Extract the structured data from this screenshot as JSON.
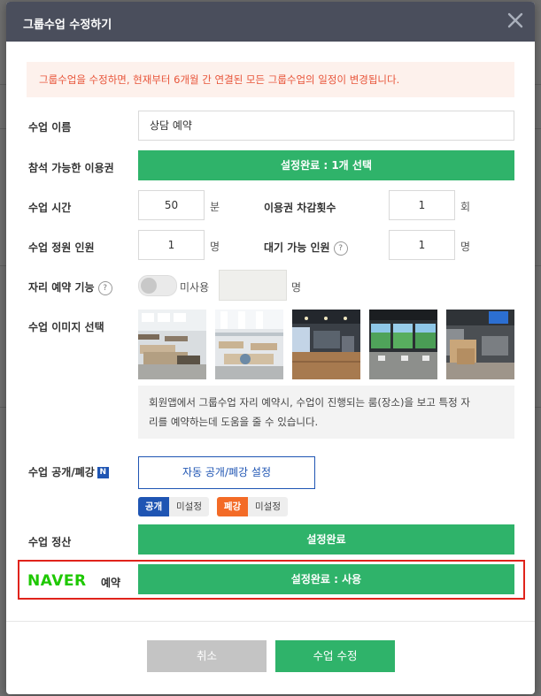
{
  "modal": {
    "title": "그룹수업 수정하기",
    "notice": "그룹수업을 수정하면, 현재부터 6개월 간 연결된 모든 그룹수업의 일정이 변경됩니다."
  },
  "form": {
    "class_name": {
      "label": "수업 이름",
      "value": "상담 예약"
    },
    "pass": {
      "label": "참석 가능한 이용권",
      "button": "설정완료 : 1개 선택"
    },
    "duration": {
      "label": "수업 시간",
      "value": "50",
      "unit": "분"
    },
    "deduct": {
      "label": "이용권 차감횟수",
      "value": "1",
      "unit": "회"
    },
    "capacity": {
      "label": "수업 정원 인원",
      "value": "1",
      "unit": "명"
    },
    "waitlist": {
      "label": "대기 가능 인원",
      "help": "?",
      "value": "1",
      "unit": "명"
    },
    "seat": {
      "label": "자리 예약 기능",
      "help": "?",
      "toggle_state": "미사용",
      "unit": "명"
    },
    "images": {
      "label": "수업 이미지 선택",
      "info": "회원앱에서 그룹수업 자리 예약시, 수업이 진행되는 룸(장소)을 보고 특정 자리를 예약하는데 도움을 줄 수 있습니다.",
      "info_line1": "회원앱에서 그룹수업 자리 예약시, 수업이 진행되는 룸(장소)을 보고 특정 자",
      "info_line2": "리를 예약하는데 도움을 줄 수 있습니다."
    },
    "open_close": {
      "label": "수업 공개/폐강",
      "badge": "N",
      "button": "자동 공개/폐강 설정",
      "open_tag": "공개",
      "open_status": "미설정",
      "close_tag": "폐강",
      "close_status": "미설정"
    },
    "settlement": {
      "label": "수업 정산",
      "button": "설정완료"
    },
    "naver": {
      "logo": "NAVER",
      "suffix": "예약",
      "button": "설정완료 : 사용"
    }
  },
  "footer": {
    "cancel": "취소",
    "submit": "수업 수정"
  },
  "colors": {
    "header": "#4a4e5c",
    "green": "#2fb36a",
    "blue": "#1f55b3",
    "orange": "#f36b27",
    "red_outline": "#e0231b",
    "naver_green": "#1ec800"
  }
}
